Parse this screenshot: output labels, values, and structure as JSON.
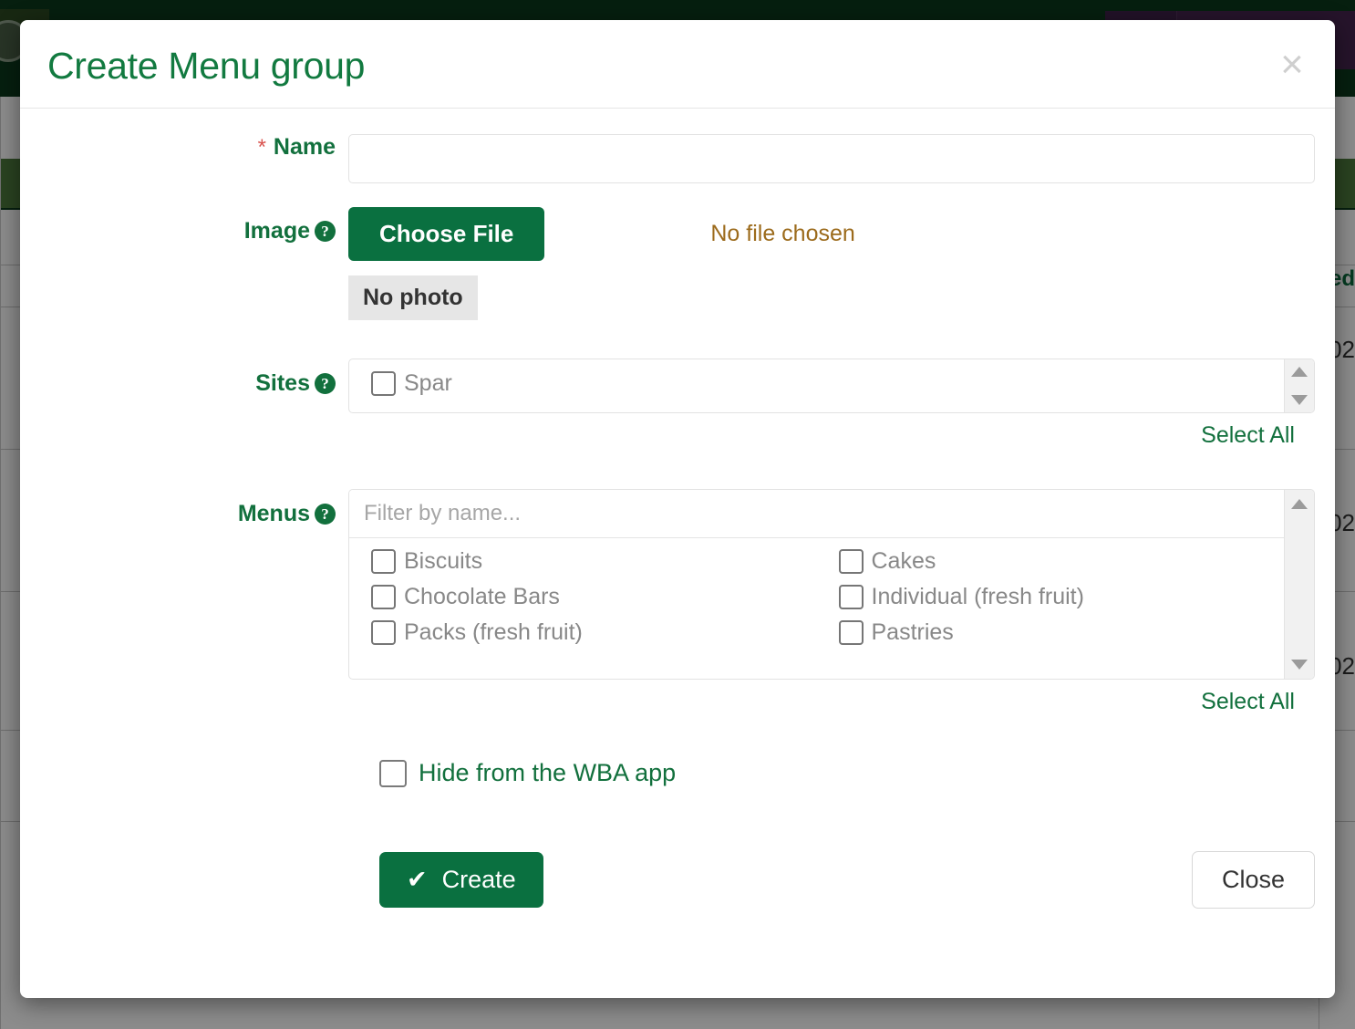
{
  "background": {
    "column_header_partial": "ed",
    "cell_partials": [
      "02",
      "02",
      "02"
    ],
    "chevron_icon": "chevron-left-icon"
  },
  "modal": {
    "title": "Create Menu group",
    "close_icon": "×",
    "fields": {
      "name": {
        "label": "Name",
        "required_marker": "*",
        "value": "",
        "placeholder": ""
      },
      "image": {
        "label": "Image",
        "help_icon": "?",
        "choose_file_label": "Choose File",
        "no_file_text": "No file chosen",
        "no_photo_text": "No photo"
      },
      "sites": {
        "label": "Sites",
        "help_icon": "?",
        "options": [
          {
            "label": "Spar",
            "checked": false
          }
        ],
        "select_all_label": "Select All"
      },
      "menus": {
        "label": "Menus",
        "help_icon": "?",
        "filter_placeholder": "Filter by name...",
        "filter_value": "",
        "options": [
          {
            "label": "Biscuits",
            "checked": false
          },
          {
            "label": "Cakes",
            "checked": false
          },
          {
            "label": "Chocolate Bars",
            "checked": false
          },
          {
            "label": "Individual (fresh fruit)",
            "checked": false
          },
          {
            "label": "Packs (fresh fruit)",
            "checked": false
          },
          {
            "label": "Pastries",
            "checked": false
          }
        ],
        "select_all_label": "Select All"
      },
      "hide_from_app": {
        "label": "Hide from the WBA app",
        "checked": false
      }
    },
    "footer": {
      "create_label": "Create",
      "create_icon": "✔",
      "close_label": "Close"
    }
  },
  "colors": {
    "brand_green": "#0a7040",
    "title_green": "#127a40",
    "warning_brown": "#9c6b1c",
    "required_red": "#d9534f",
    "nav_dark_green": "#0c3a1c",
    "nav_purple": "#46254f",
    "banner_green": "#4d7a3c"
  }
}
